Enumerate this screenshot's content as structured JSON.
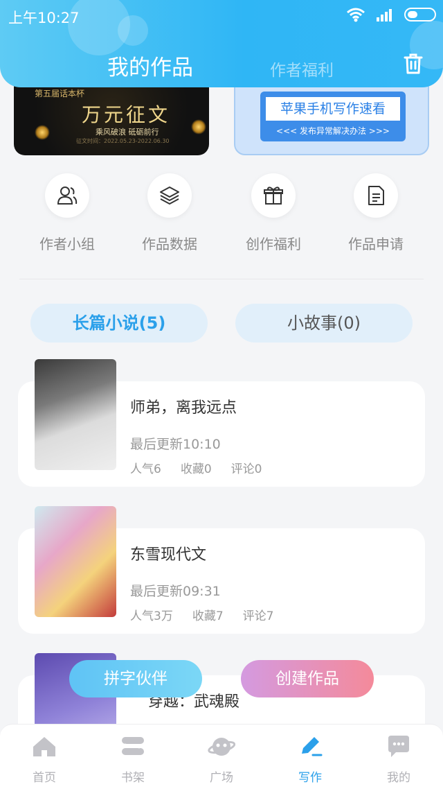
{
  "status_bar": {
    "time": "上午10:27"
  },
  "header": {
    "tab_active": "我的作品",
    "tab_inactive": "作者福利"
  },
  "banners": {
    "left": {
      "line1": "第五届话本杯",
      "headline": "万元征文",
      "subline": "乘风破浪 砥砺前行",
      "date": "征文时间：2022.05.23-2022.06.30"
    },
    "right": {
      "headline": "苹果手机写作速看",
      "subline": "<<< 发布异常解决办法 >>>"
    }
  },
  "actions": [
    {
      "label": "作者小组",
      "icon": "people-icon"
    },
    {
      "label": "作品数据",
      "icon": "layers-icon"
    },
    {
      "label": "创作福利",
      "icon": "gift-icon"
    },
    {
      "label": "作品申请",
      "icon": "document-icon"
    }
  ],
  "tabs": {
    "long_novel": "长篇小说(5)",
    "short_story": "小故事(0)"
  },
  "books": [
    {
      "title": "师弟，离我远点",
      "updated": "最后更新10:10",
      "popularity": "人气6",
      "favorites": "收藏0",
      "comments": "评论0"
    },
    {
      "title": "东雪现代文",
      "updated": "最后更新09:31",
      "popularity": "人气3万",
      "favorites": "收藏7",
      "comments": "评论7"
    },
    {
      "title": "穿越：武魂殿"
    }
  ],
  "floating_buttons": {
    "partner": "拼字伙伴",
    "create": "创建作品"
  },
  "bottom_nav": [
    {
      "label": "首页",
      "icon": "home-icon"
    },
    {
      "label": "书架",
      "icon": "bookshelf-icon"
    },
    {
      "label": "广场",
      "icon": "planet-icon"
    },
    {
      "label": "写作",
      "icon": "pen-icon",
      "active": true
    },
    {
      "label": "我的",
      "icon": "chat-icon"
    }
  ],
  "colors": {
    "accent": "#2ba0ea",
    "header": "#35b8f6",
    "create_button": "#f48a9a"
  }
}
